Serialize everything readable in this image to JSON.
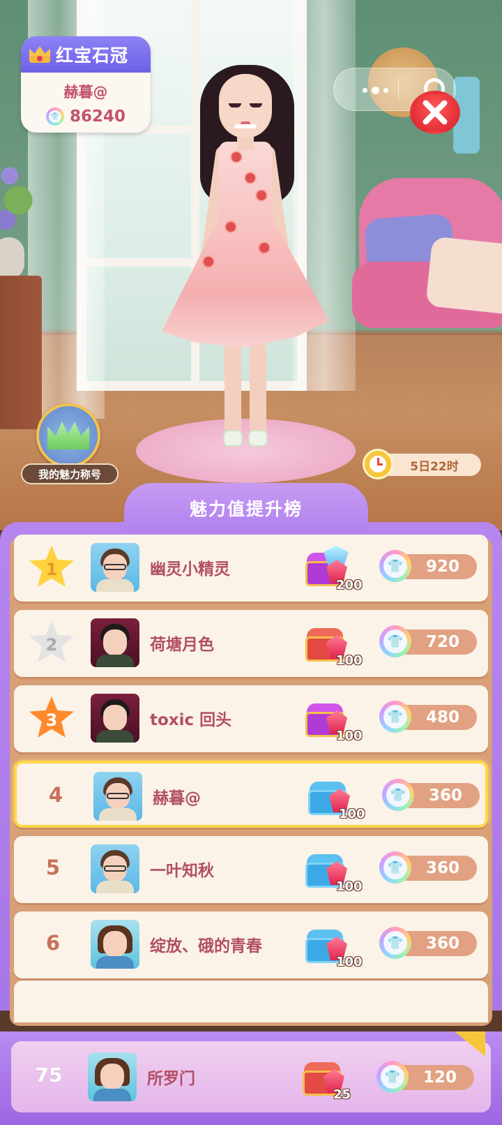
{
  "profile": {
    "title": "红宝石冠",
    "name": "赫暮@",
    "score": "86240"
  },
  "charm_title_button": "我的魅力称号",
  "timer": "5日22时",
  "panel_title": "魅力值提升榜",
  "rows": [
    {
      "rank": "1",
      "name": "幽灵小精灵",
      "reward_count": "200",
      "score": "920"
    },
    {
      "rank": "2",
      "name": "荷塘月色",
      "reward_count": "100",
      "score": "720"
    },
    {
      "rank": "3",
      "name": "toxic 回头",
      "reward_count": "100",
      "score": "480"
    },
    {
      "rank": "4",
      "name": "赫暮@",
      "reward_count": "100",
      "score": "360"
    },
    {
      "rank": "5",
      "name": "一叶知秋",
      "reward_count": "100",
      "score": "360"
    },
    {
      "rank": "6",
      "name": "绽放、硪的青春",
      "reward_count": "100",
      "score": "360"
    }
  ],
  "my_rank": {
    "rank": "75",
    "name": "所罗门",
    "reward_count": "25",
    "score": "120"
  },
  "icons": {
    "currency": "shirt-coin-icon",
    "close": "close-icon",
    "more": "more-icon",
    "crown": "crown-icon",
    "alarm": "alarm-clock-icon",
    "reward": "treasure-chest-icon"
  },
  "colors": {
    "panel_purple": "#b182ee",
    "name_text": "#b24f63",
    "highlight_border": "#ffd64a"
  }
}
